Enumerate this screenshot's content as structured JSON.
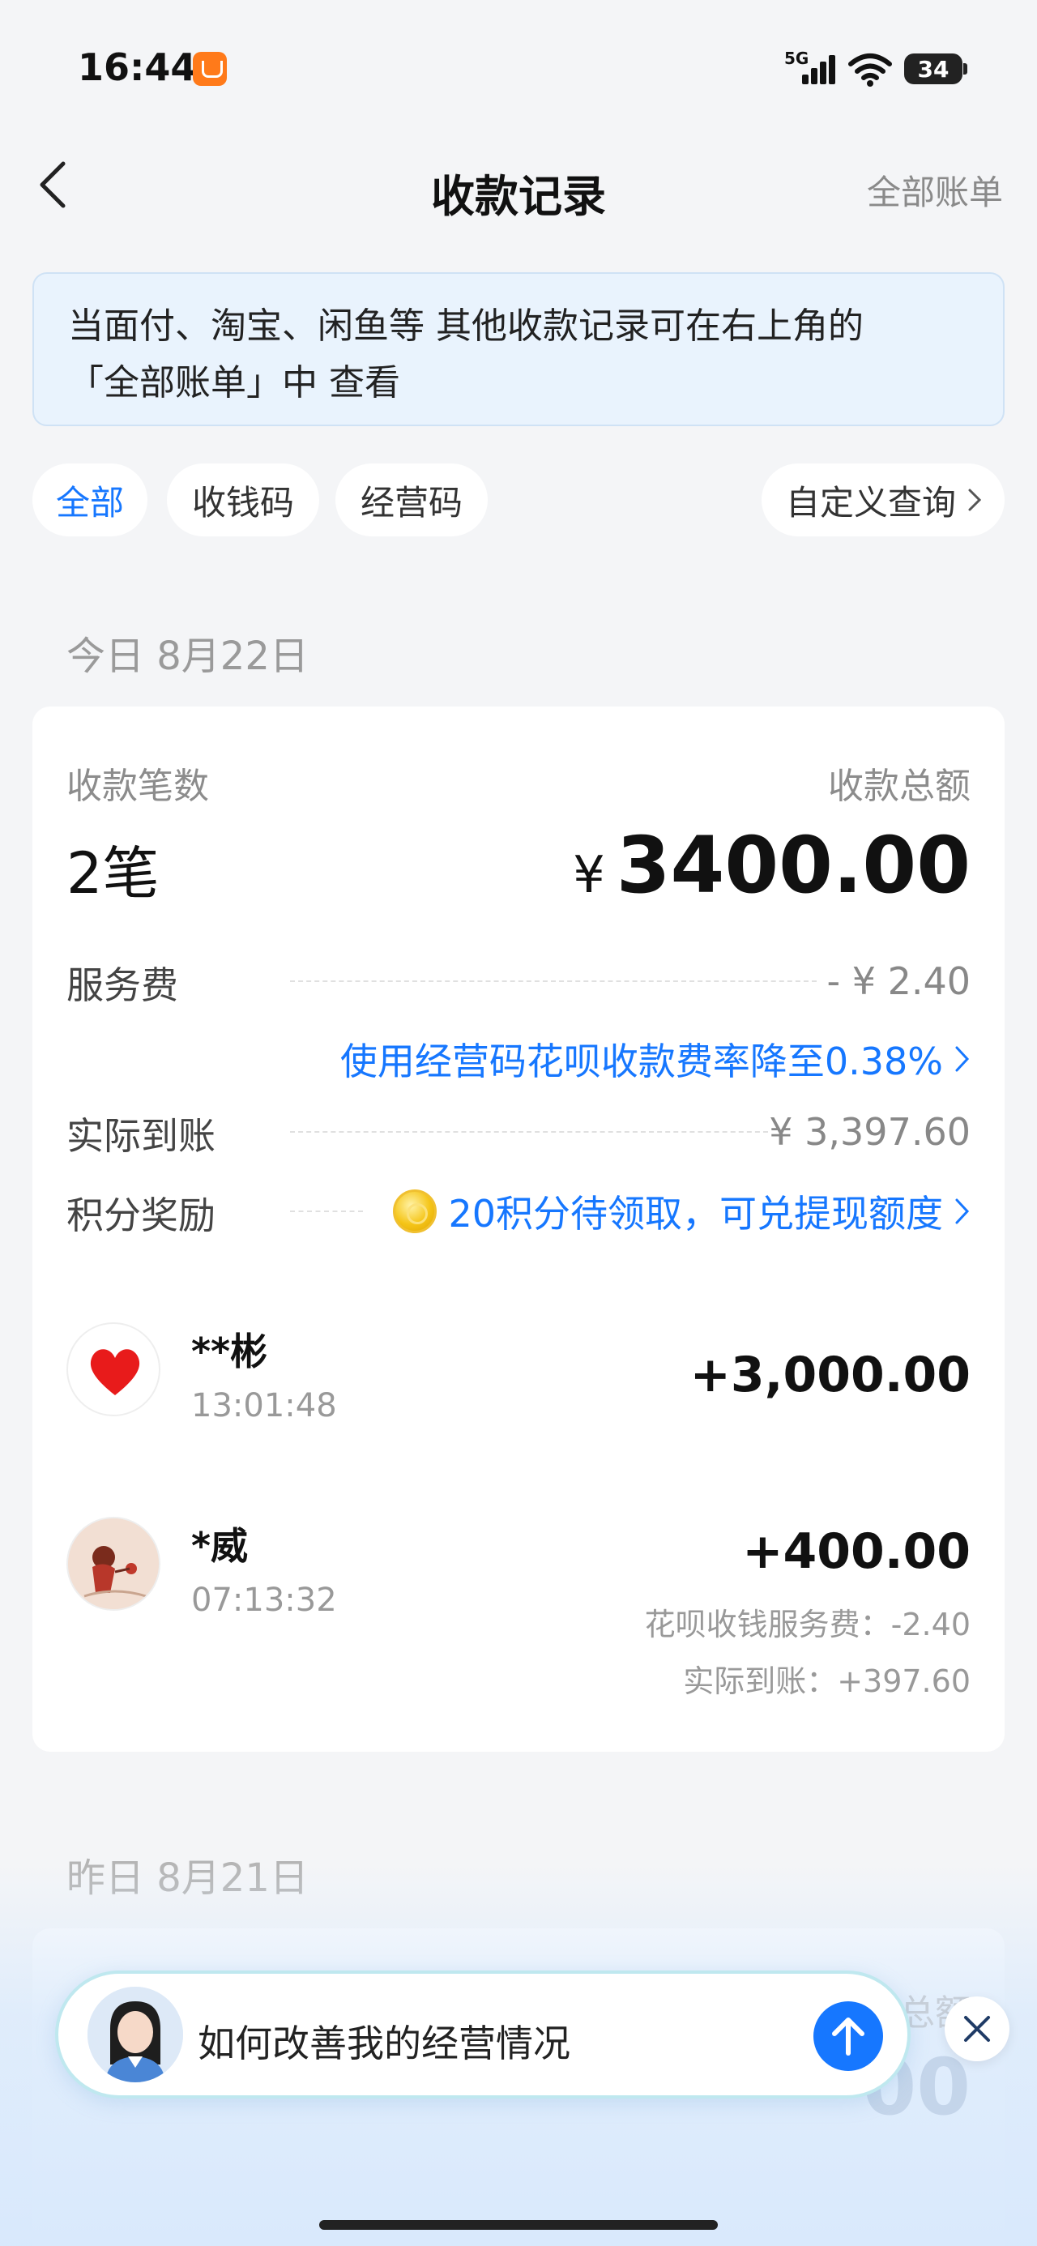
{
  "status_bar": {
    "time": "16:44",
    "network": "5G",
    "battery": "34"
  },
  "nav": {
    "title": "收款记录",
    "right_link": "全部账单"
  },
  "tip": {
    "line1": "当面付、淘宝、闲鱼等 其他收款记录可在右上角的",
    "line2": "「全部账单」中 查看"
  },
  "filters": {
    "all": "全部",
    "qr": "收钱码",
    "business": "经营码",
    "custom": "自定义查询"
  },
  "today": {
    "date": "今日 8月22日",
    "count_label": "收款笔数",
    "count_value": "2笔",
    "total_label": "收款总额",
    "total_currency": "¥",
    "total_value": "3400.00",
    "service_fee_label": "服务费",
    "service_fee_value": "- ¥ 2.40",
    "promo": "使用经营码花呗收款费率降至0.38%",
    "net_label": "实际到账",
    "net_value": "¥ 3,397.60",
    "points_label": "积分奖励",
    "points_value": "20积分待领取，可兑提现额度"
  },
  "transactions": [
    {
      "name": "**彬",
      "time": "13:01:48",
      "amount": "+3,000.00",
      "avatar": "heart-icon"
    },
    {
      "name": "*威",
      "time": "07:13:32",
      "amount": "+400.00",
      "fee": "花呗收钱服务费：-2.40",
      "net": "实际到账：+397.60",
      "avatar": "illustrated-avatar"
    }
  ],
  "yesterday": {
    "date": "昨日 8月21日",
    "total_label_partial": "总额",
    "total_partial": "00"
  },
  "assistant": {
    "prompt": "如何改善我的经营情况"
  },
  "colors": {
    "accent": "#1677ff",
    "background": "#f4f5f7",
    "tip_bg": "#e9f3fd",
    "heart": "#e81b1b"
  }
}
